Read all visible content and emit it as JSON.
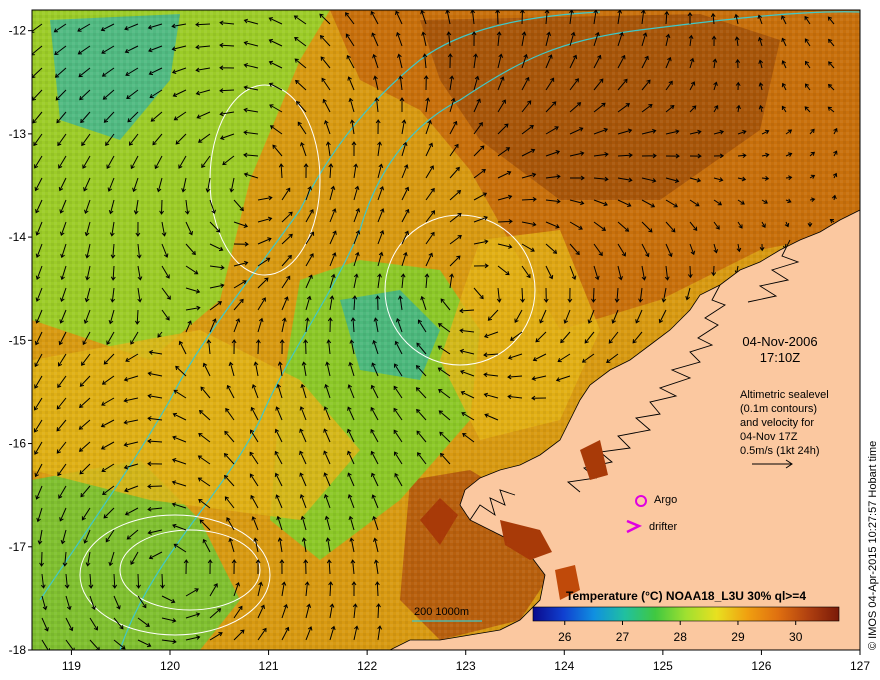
{
  "map": {
    "x_ticks": [
      "119",
      "120",
      "121",
      "122",
      "123",
      "124",
      "125",
      "126",
      "127"
    ],
    "y_ticks": [
      "-12",
      "-13",
      "-14",
      "-15",
      "-16",
      "-17",
      "-18"
    ],
    "datetime": {
      "date": "04-Nov-2006",
      "time": "17:10Z"
    },
    "altimetry_note": {
      "lines": [
        "Altimetric sealevel",
        "(0.1m contours)",
        "and velocity for",
        "04-Nov 17Z",
        "0.5m/s (1kt 24h)"
      ]
    },
    "legend": {
      "argo_label": "Argo",
      "drifter_label": "drifter",
      "argo_color": "#e000e0",
      "drifter_color": "#e000e0"
    },
    "bathymetry_label": "200  1000m",
    "bathymetry_color": "#40c8c8",
    "colorbar": {
      "title": "Temperature (°C) NOAA18_L3U 30% ql>=4",
      "ticks": [
        "26",
        "27",
        "28",
        "29",
        "30"
      ],
      "colors": [
        "#0a0a8c",
        "#1040d0",
        "#1090e0",
        "#20c0a0",
        "#40c840",
        "#a0e030",
        "#e8e020",
        "#f0a010",
        "#e07010",
        "#b04010",
        "#7a1a08"
      ]
    },
    "credit": "© IMOS 04-Apr-2015 10:27:57 Hobart time",
    "land_color": "#fbc8a0"
  }
}
